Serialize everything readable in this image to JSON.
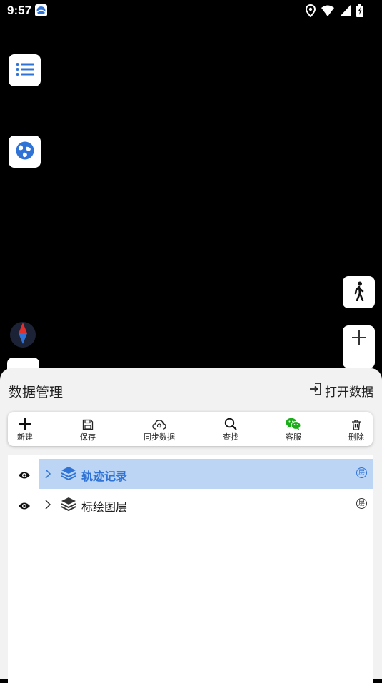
{
  "status_bar": {
    "time": "9:57"
  },
  "icons": {
    "app_notification": "app-notification-icon",
    "location": "location-icon",
    "wifi": "wifi-icon",
    "signal": "cellular-signal-icon",
    "battery": "battery-charging-icon",
    "list": "list-icon",
    "globe": "globe-icon",
    "walk": "walk-icon",
    "compass": "compass-icon",
    "zoom_in": "plus-icon",
    "open": "open-data-icon",
    "eye": "eye-icon",
    "layers": "layers-icon"
  },
  "panel": {
    "title": "数据管理",
    "open_data": "打开数据"
  },
  "toolbar": {
    "new": "新建",
    "save": "保存",
    "sync": "同步数据",
    "find": "查找",
    "service": "客服",
    "delete": "删除"
  },
  "layers": [
    {
      "label": "轨迹记录",
      "badge": "层",
      "selected": true
    },
    {
      "label": "标绘图层",
      "badge": "层",
      "selected": false
    }
  ],
  "colors": {
    "accent": "#2f73d6",
    "selected_row": "#bcd5f4",
    "wechat_green": "#1aad19",
    "compass_red": "#e0302d",
    "compass_blue": "#2f73d6"
  }
}
